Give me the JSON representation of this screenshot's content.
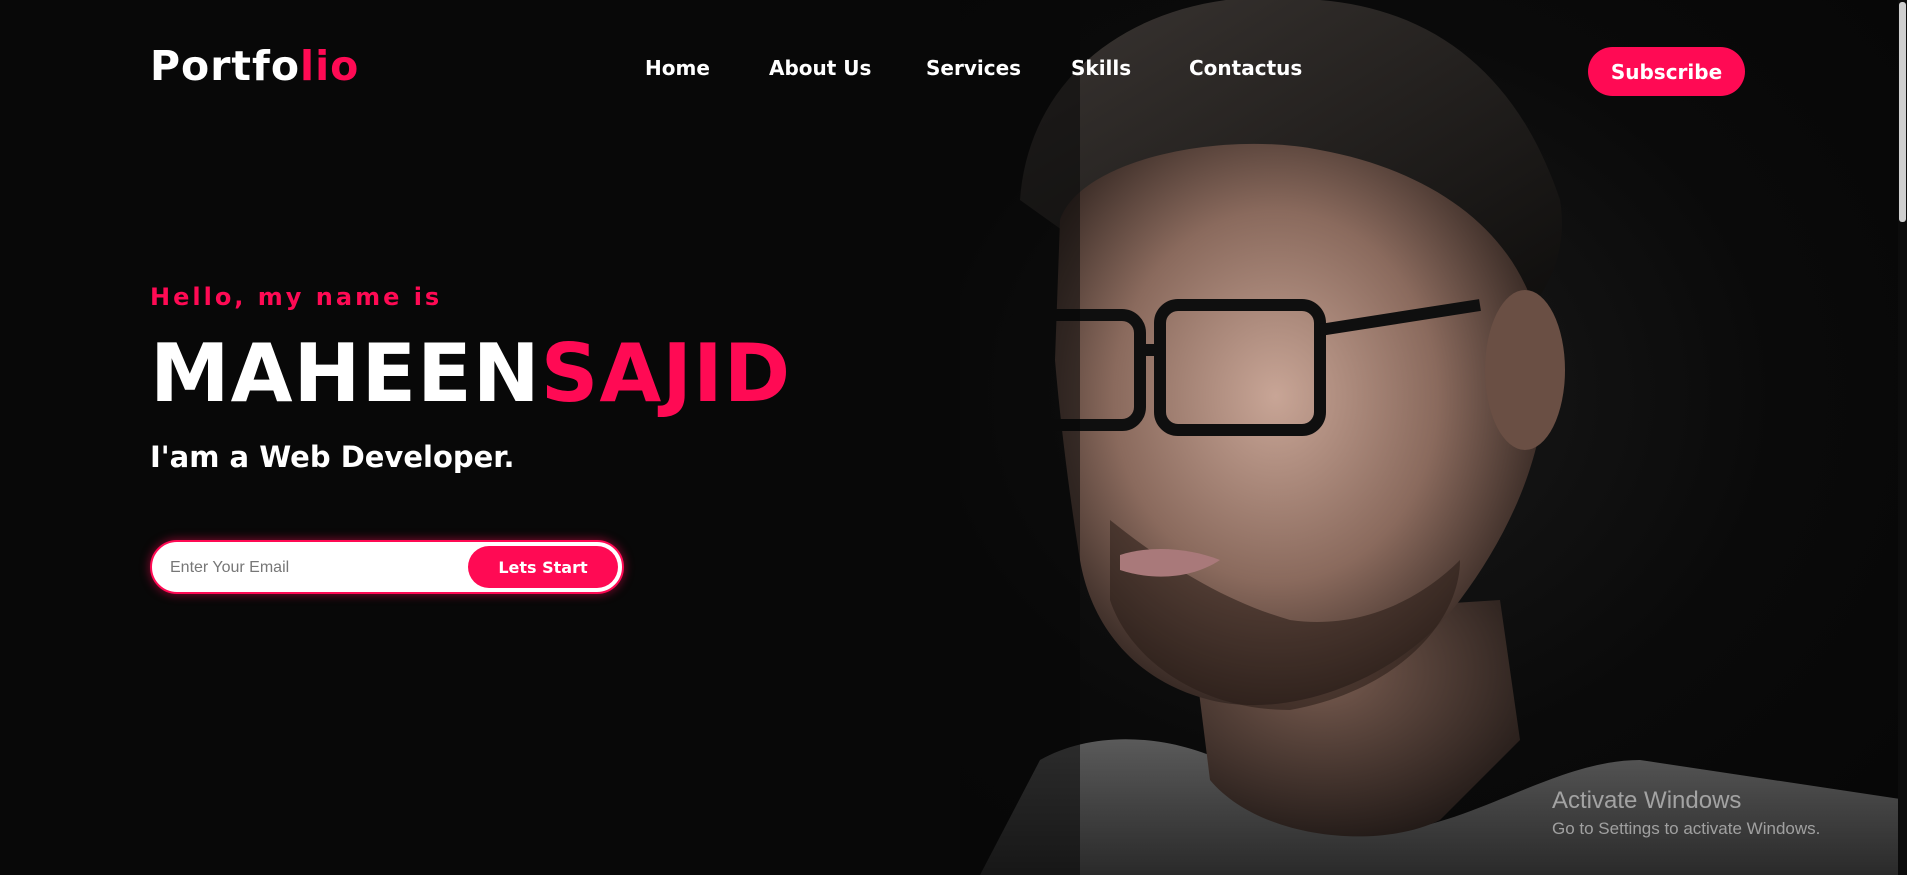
{
  "header": {
    "logo_part1": "Portfo",
    "logo_part2": "lio",
    "nav": [
      "Home",
      "About Us",
      "Services",
      "Skills",
      "Contactus"
    ],
    "subscribe_label": "Subscribe"
  },
  "hero": {
    "greeting": "Hello, my name is",
    "first_name": "MAHEEN",
    "last_name": "SAJID",
    "role": "I'am a Web Developer.",
    "email_placeholder": "Enter Your Email",
    "cta_label": "Lets Start",
    "photo_icon": "portrait-photo"
  },
  "watermark": {
    "title": "Activate Windows",
    "subtitle": "Go to Settings to activate Windows."
  },
  "colors": {
    "accent": "#ff0a54",
    "background": "#080808",
    "text": "#ffffff"
  }
}
